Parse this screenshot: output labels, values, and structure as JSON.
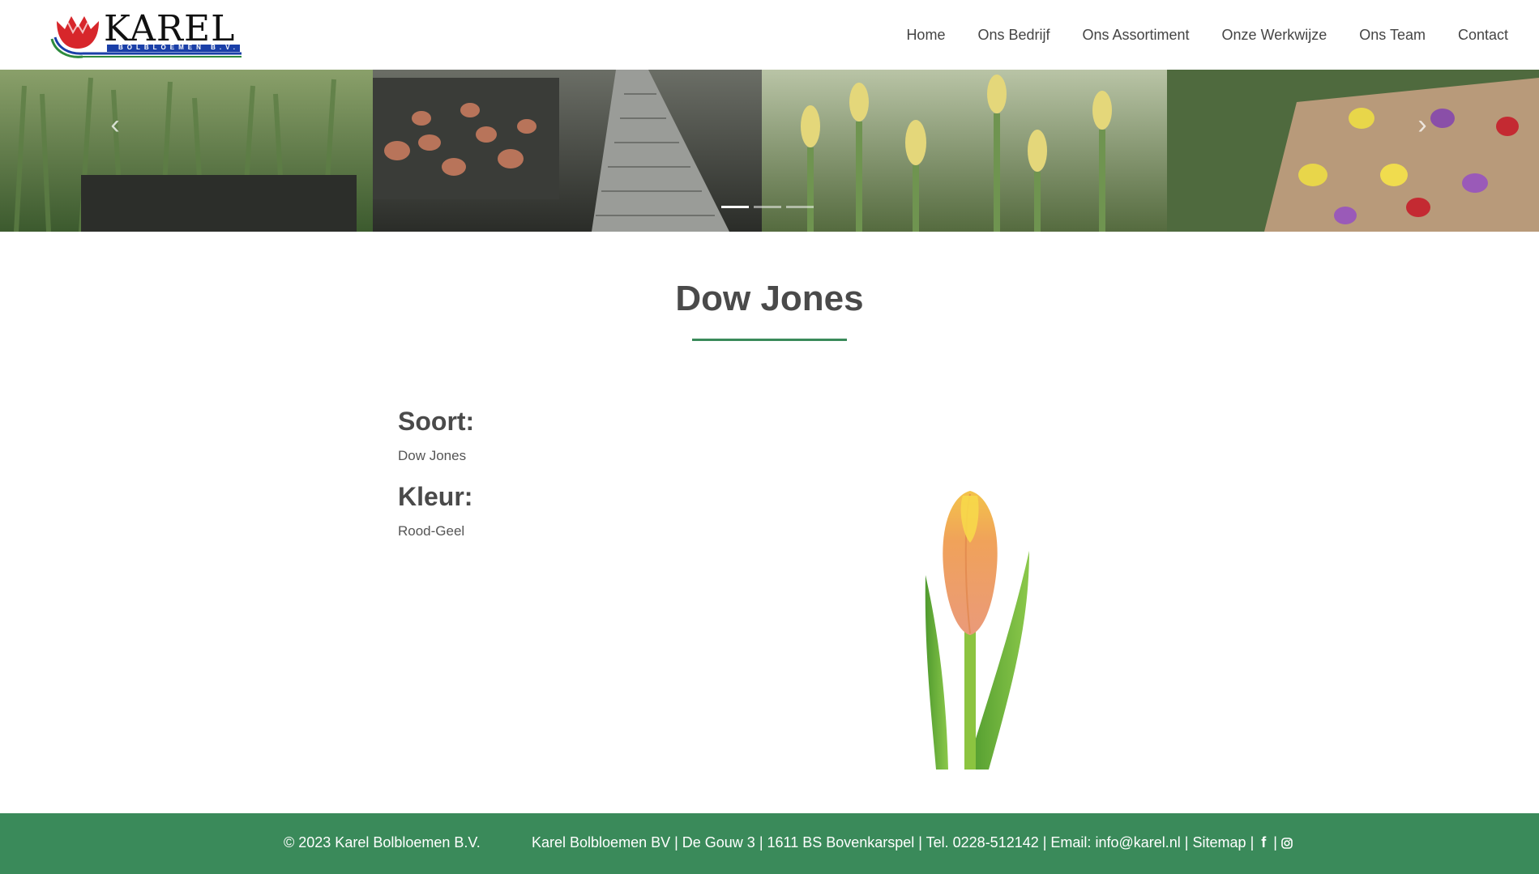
{
  "brand": {
    "name": "KAREL",
    "tagline": "BOLBLOEMEN B.V."
  },
  "nav": {
    "items": [
      "Home",
      "Ons Bedrijf",
      "Ons Assortiment",
      "Onze Werkwijze",
      "Ons Team",
      "Contact"
    ]
  },
  "carousel": {
    "prev_icon": "chevron-left-icon",
    "next_icon": "chevron-right-icon",
    "slides": 3,
    "active_slide": 1
  },
  "product": {
    "title": "Dow Jones",
    "soort_label": "Soort:",
    "soort_value": "Dow Jones",
    "kleur_label": "Kleur:",
    "kleur_value": "Rood-Geel"
  },
  "footer": {
    "copyright": "© 2023 Karel Bolbloemen B.V.",
    "address": "Karel Bolbloemen BV | De Gouw 3 | 1611 BS Bovenkarspel | Tel. 0228-512142 | Email:",
    "email": "info@karel.nl",
    "sep1": "|",
    "sitemap": "Sitemap",
    "sep2": "|",
    "sep3": "|",
    "facebook_icon": "facebook-icon",
    "instagram_icon": "instagram-icon"
  },
  "colors": {
    "accent": "#3a8a5a",
    "logo_red": "#d7262b",
    "logo_blue": "#1a3fa8"
  }
}
